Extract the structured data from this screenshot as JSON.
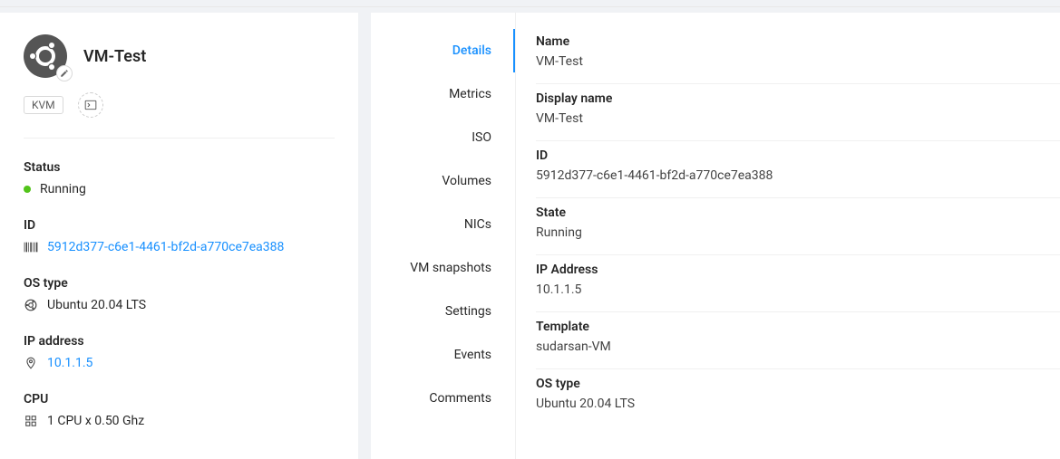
{
  "left": {
    "title": "VM-Test",
    "chip_hypervisor": "KVM",
    "status": {
      "label": "Status",
      "value": "Running",
      "color": "#52c41a"
    },
    "id": {
      "label": "ID",
      "value": "5912d377-c6e1-4461-bf2d-a770ce7ea388"
    },
    "os_type": {
      "label": "OS type",
      "value": "Ubuntu 20.04 LTS"
    },
    "ip": {
      "label": "IP address",
      "value": "10.1.1.5"
    },
    "cpu": {
      "label": "CPU",
      "value": "1 CPU x 0.50 Ghz"
    }
  },
  "tabs": [
    "Details",
    "Metrics",
    "ISO",
    "Volumes",
    "NICs",
    "VM snapshots",
    "Settings",
    "Events",
    "Comments"
  ],
  "active_tab": 0,
  "details": {
    "name": {
      "label": "Name",
      "value": "VM-Test"
    },
    "display_name": {
      "label": "Display name",
      "value": "VM-Test"
    },
    "id": {
      "label": "ID",
      "value": "5912d377-c6e1-4461-bf2d-a770ce7ea388"
    },
    "state": {
      "label": "State",
      "value": "Running"
    },
    "ip_address": {
      "label": "IP Address",
      "value": "10.1.1.5"
    },
    "template": {
      "label": "Template",
      "value": "sudarsan-VM"
    },
    "os_type": {
      "label": "OS type",
      "value": "Ubuntu 20.04 LTS"
    }
  }
}
